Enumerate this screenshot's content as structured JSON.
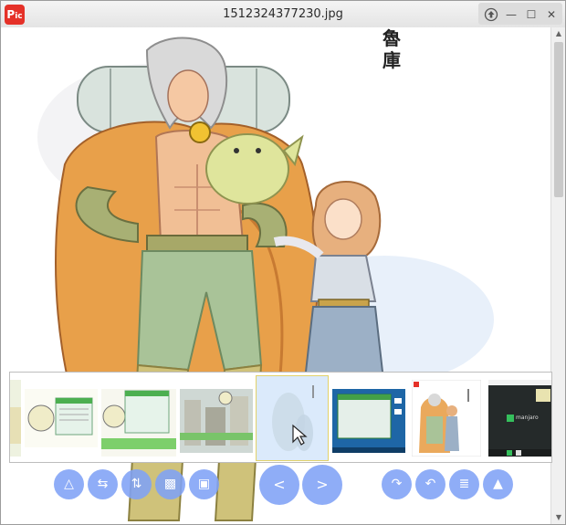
{
  "window": {
    "title": "1512324377230.jpg",
    "logo_text": "Pic",
    "buttons": {
      "pin_icon": "up-arrow-icon",
      "minimize_label": "—",
      "maximize_label": "☐",
      "close_label": "✕"
    }
  },
  "image": {
    "caption": "魯庫"
  },
  "filmstrip": {
    "thumbnails": [
      {
        "name": "rage-comic-1",
        "selected": false
      },
      {
        "name": "rage-comic-2",
        "selected": false
      },
      {
        "name": "rage-comic-3",
        "selected": false
      },
      {
        "name": "rage-comic-4",
        "selected": false
      },
      {
        "name": "current-image",
        "selected": true
      },
      {
        "name": "desktop-screenshot",
        "selected": false
      },
      {
        "name": "illustration",
        "selected": false
      },
      {
        "name": "manjaro-desktop",
        "selected": false
      }
    ],
    "manjaro_label": "manjaro"
  },
  "toolbar": {
    "flip": "△",
    "flip_h": "⇆",
    "flip_v": "⇅",
    "transparency": "▩",
    "fit": "▣",
    "prev": "<",
    "next": ">",
    "rotate_right": "↷",
    "rotate_left": "↶",
    "menu": "≣",
    "up": "▲"
  },
  "colors": {
    "accent": "#80a2f6",
    "logo": "#e53128"
  }
}
